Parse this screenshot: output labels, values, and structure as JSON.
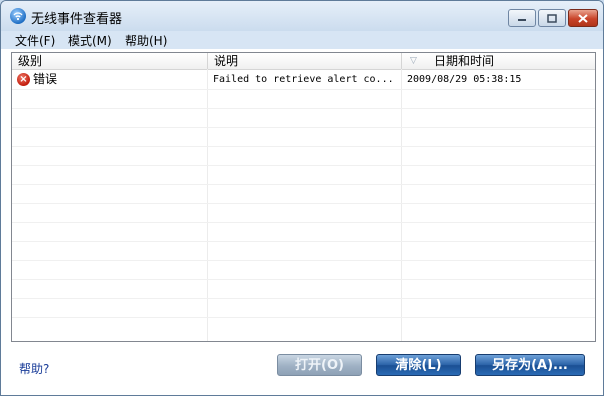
{
  "window": {
    "title": "无线事件查看器"
  },
  "menu": [
    "文件(F)",
    "模式(M)",
    "帮助(H)"
  ],
  "columns": {
    "level": "级别",
    "description": "说明",
    "datetime": "日期和时间"
  },
  "rows": [
    {
      "level": "错误",
      "description": "Failed to retrieve alert co...",
      "datetime": "2009/08/29 05:38:15",
      "icon": "error-icon"
    }
  ],
  "footer": {
    "help": "帮助?",
    "open": "打开(O)",
    "clear": "清除(L)",
    "save_as": "另存为(A)..."
  },
  "colors": {
    "error": "#c21b0b",
    "button_primary": "#2a62a8",
    "link": "#1a3d99"
  }
}
